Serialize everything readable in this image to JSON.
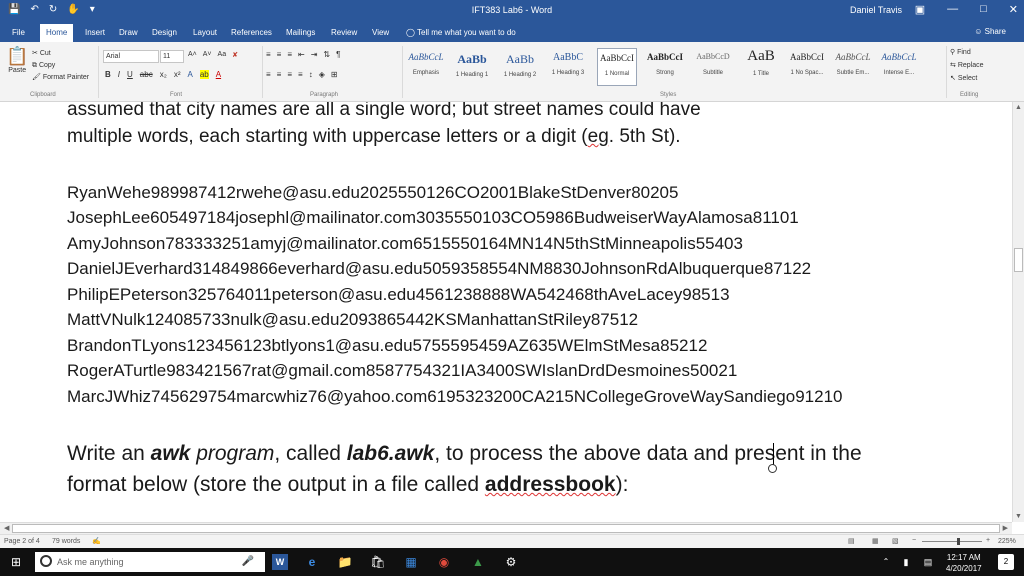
{
  "app": {
    "title": "IFT383 Lab6",
    "app_name": "Word",
    "user": "Daniel Travis",
    "share": "Share"
  },
  "tabs": [
    {
      "label": "File",
      "active": false
    },
    {
      "label": "Home",
      "active": true
    },
    {
      "label": "Insert",
      "active": false
    },
    {
      "label": "Draw",
      "active": false
    },
    {
      "label": "Design",
      "active": false
    },
    {
      "label": "Layout",
      "active": false
    },
    {
      "label": "References",
      "active": false
    },
    {
      "label": "Mailings",
      "active": false
    },
    {
      "label": "Review",
      "active": false
    },
    {
      "label": "View",
      "active": false
    }
  ],
  "tell_me": "Tell me what you want to do",
  "ribbon": {
    "clipboard": {
      "paste": "Paste",
      "cut": "Cut",
      "copy": "Copy",
      "format_painter": "Format Painter",
      "label": "Clipboard"
    },
    "font": {
      "name": "Arial",
      "size": "11",
      "label": "Font"
    },
    "paragraph": {
      "label": "Paragraph"
    },
    "styles": {
      "label": "Styles",
      "items": [
        {
          "preview": "AaBbCcL",
          "name": "Emphasis"
        },
        {
          "preview": "AaBb",
          "name": "1 Heading 1"
        },
        {
          "preview": "AaBb",
          "name": "1 Heading 2"
        },
        {
          "preview": "AaBbC",
          "name": "1 Heading 3"
        },
        {
          "preview": "AaBbCcI",
          "name": "1 Normal",
          "selected": true
        },
        {
          "preview": "AaBbCcI",
          "name": "Strong"
        },
        {
          "preview": "AaBbCcD",
          "name": "Subtitle"
        },
        {
          "preview": "AaB",
          "name": "1 Title"
        },
        {
          "preview": "AaBbCcI",
          "name": "1 No Spac..."
        },
        {
          "preview": "AaBbCcL",
          "name": "Subtle Em..."
        },
        {
          "preview": "AaBbCcL",
          "name": "Intense E..."
        }
      ]
    },
    "editing": {
      "find": "Find",
      "replace": "Replace",
      "select": "Select",
      "label": "Editing"
    }
  },
  "document": {
    "line1": "assumed that city names are all a single word; but street names could have",
    "line2_a": "multiple words, each starting with uppercase letters or a digit (",
    "line2_eg": "eg",
    "line2_b": ". 5th St).",
    "records": [
      "RyanWehe989987412rwehe@asu.edu2025550126CO2001BlakeStDenver80205",
      "JosephLee605497184josephl@mailinator.com3035550103CO5986BudweiserWayAlamosa81101",
      "AmyJohnson783333251amyj@mailinator.com6515550164MN14N5thStMinneapolis55403",
      "DanielJEverhard314849866everhard@asu.edu5059358554NM8830JohnsonRdAlbuquerque87122",
      "PhilipEPeterson325764011peterson@asu.edu4561238888WA542468thAveLacey98513",
      "MattVNulk124085733nulk@asu.edu2093865442KSManhattanStRiley87512",
      "BrandonTLyons123456123btlyons1@asu.edu5755595459AZ635WElmStMesa85212",
      "RogerATurtle983421567rat@gmail.com8587754321IA3400SWIslanDrdDesmoines50021",
      "MarcJWhiz745629754marcwhiz76@yahoo.com6195323200CA215NCollegeGroveWaySandiego91210"
    ],
    "instr_a": "Write an ",
    "instr_awk": "awk",
    "instr_prog": " program",
    "instr_b": ", called ",
    "instr_file": "lab6.awk",
    "instr_c": ", to process the above data and present in the",
    "instr_d": "format below (store the output in a file called ",
    "instr_out": "addressbook",
    "instr_e": "):"
  },
  "status": {
    "page": "Page 2 of 4",
    "words": "79 words",
    "zoom": "225%"
  },
  "taskbar": {
    "search": "Ask me anything",
    "time": "12:17 AM",
    "date": "4/20/2017",
    "notifications": "2"
  }
}
